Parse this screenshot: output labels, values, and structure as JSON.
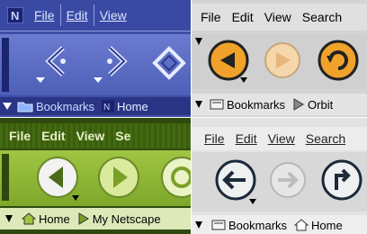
{
  "quads": {
    "q1": {
      "menu": [
        "File",
        "Edit",
        "View"
      ],
      "bookmarks": [
        "Bookmarks",
        "Home"
      ]
    },
    "q2": {
      "menu": [
        "File",
        "Edit",
        "View",
        "Search"
      ],
      "bookmarks": [
        "Bookmarks",
        "Orbit"
      ]
    },
    "q3": {
      "menu": [
        "File",
        "Edit",
        "View",
        "Se"
      ],
      "bookmarks": [
        "Home",
        "My Netscape"
      ]
    },
    "q4": {
      "menu": [
        "File",
        "Edit",
        "View",
        "Search"
      ],
      "bookmarks": [
        "Bookmarks",
        "Home"
      ]
    }
  },
  "icons": {
    "q1_logo": "n-logo-icon",
    "nav": [
      "back-icon",
      "forward-icon",
      "reload-icon"
    ],
    "bookmark_folder": "folder-icon",
    "home": "home-icon",
    "netscape": "netscape-icon"
  },
  "colors": {
    "q1_bg": "#3e4fa6",
    "q2_accent": "#f0a22a",
    "q3_bg": "#7ea72a",
    "q4_bg": "#d8d8d8"
  }
}
